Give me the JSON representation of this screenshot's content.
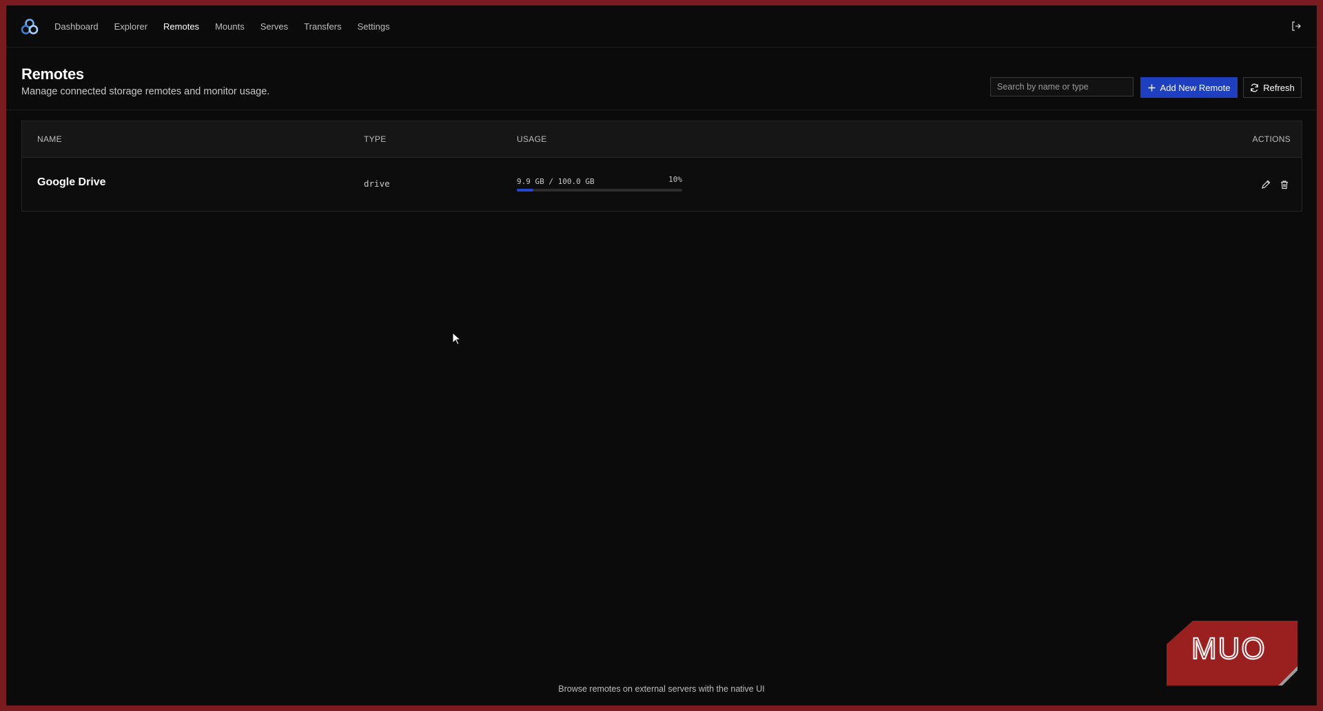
{
  "nav": {
    "items": [
      {
        "label": "Dashboard",
        "active": false
      },
      {
        "label": "Explorer",
        "active": false
      },
      {
        "label": "Remotes",
        "active": true
      },
      {
        "label": "Mounts",
        "active": false
      },
      {
        "label": "Serves",
        "active": false
      },
      {
        "label": "Transfers",
        "active": false
      },
      {
        "label": "Settings",
        "active": false
      }
    ],
    "logo_icon": "rclone-logo-icon",
    "logout_icon": "logout-icon"
  },
  "header": {
    "title": "Remotes",
    "subtitle": "Manage connected storage remotes and monitor usage.",
    "search_placeholder": "Search by name or type",
    "add_label": "Add New Remote",
    "refresh_label": "Refresh"
  },
  "table": {
    "columns": {
      "name": "NAME",
      "type": "TYPE",
      "usage": "USAGE",
      "actions": "ACTIONS"
    },
    "rows": [
      {
        "name": "Google Drive",
        "type": "drive",
        "usage_text": "9.9 GB / 100.0 GB",
        "usage_pct": "10%",
        "usage_fraction": 0.1
      }
    ]
  },
  "footer": {
    "link": "Browse remotes on external servers with the native UI"
  },
  "watermark": "MUO",
  "colors": {
    "accent": "#1e3fc0",
    "background": "#0b0b0b",
    "border_frame": "#7a1c1f"
  }
}
